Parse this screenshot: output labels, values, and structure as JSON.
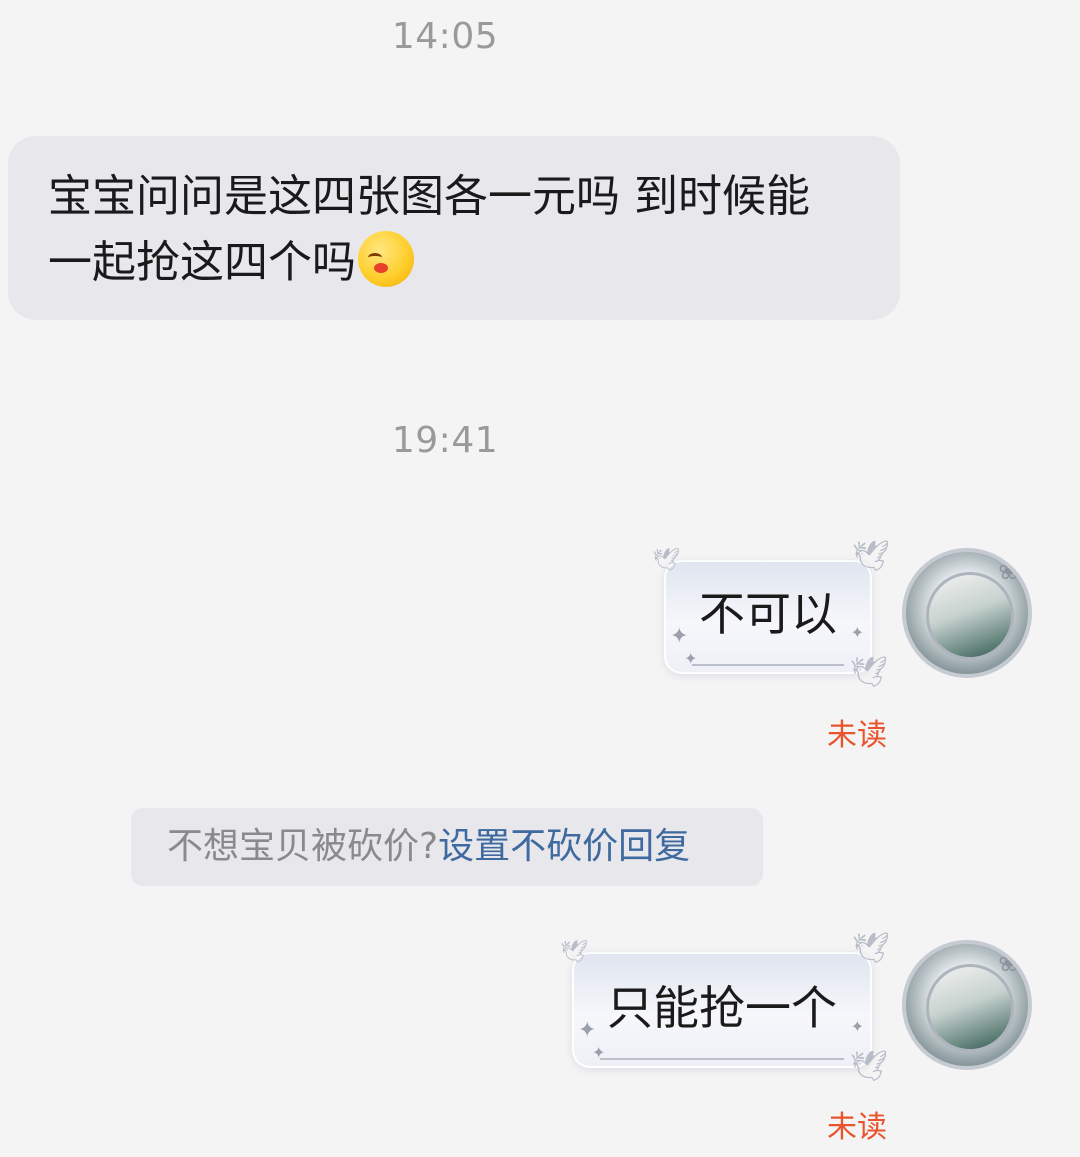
{
  "messages": {
    "time1": "14:05",
    "incoming_line1": "宝宝问问是这四张图各一元吗 到时候能",
    "incoming_line2": "一起抢这四个吗",
    "incoming_emoji": "drooling-face-emoji",
    "time2": "19:41",
    "out1_text": "不可以",
    "out1_status": "未读",
    "notice_prefix": "不想宝贝被砍价?",
    "notice_link": "设置不砍价回复",
    "out2_text": "只能抢一个",
    "out2_status": "未读"
  },
  "colors": {
    "background": "#f4f4f4",
    "incoming_bubble": "#e8e8ec",
    "unread": "#e8542c",
    "link": "#3e6aa0",
    "timestamp": "#9a9a9a"
  }
}
